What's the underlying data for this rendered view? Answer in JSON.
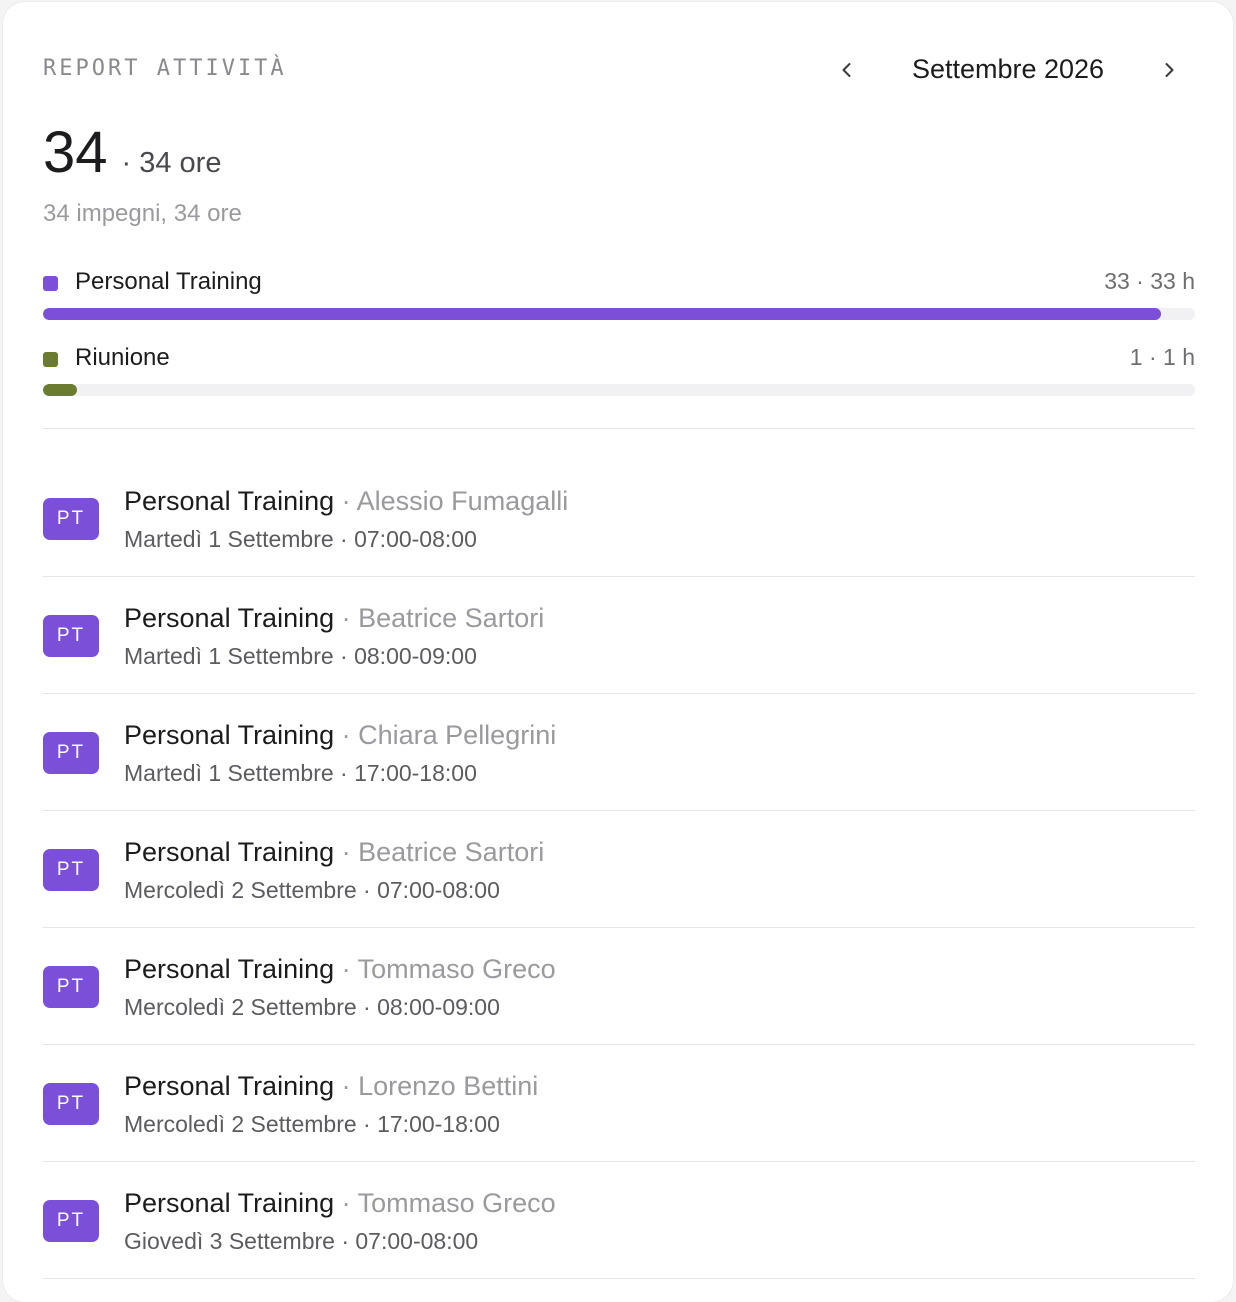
{
  "header": {
    "section_title": "REPORT ATTIVITÀ",
    "month": "Settembre 2026",
    "prev_icon": "chevron-left-icon",
    "next_icon": "chevron-right-icon"
  },
  "summary": {
    "total": "34",
    "hours": "· 34 ore",
    "subtitle": "34 impegni, 34 ore"
  },
  "categories": [
    {
      "name": "Personal Training",
      "count": "33 · 33 h",
      "color": "#7b4fd8",
      "fraction": 0.9706
    },
    {
      "name": "Riunione",
      "count": "1 · 1 h",
      "color": "#6b7b2f",
      "fraction": 0.0294
    }
  ],
  "colors": {
    "badge": "#7b4fd8"
  },
  "items": [
    {
      "badge": "PT",
      "title": "Personal Training",
      "sep": " · ",
      "client": "Alessio Fumagalli",
      "when": "Martedì 1 Settembre · 07:00-08:00"
    },
    {
      "badge": "PT",
      "title": "Personal Training",
      "sep": " · ",
      "client": "Beatrice Sartori",
      "when": "Martedì 1 Settembre · 08:00-09:00"
    },
    {
      "badge": "PT",
      "title": "Personal Training",
      "sep": " · ",
      "client": "Chiara Pellegrini",
      "when": "Martedì 1 Settembre · 17:00-18:00"
    },
    {
      "badge": "PT",
      "title": "Personal Training",
      "sep": " · ",
      "client": "Beatrice Sartori",
      "when": "Mercoledì 2 Settembre · 07:00-08:00"
    },
    {
      "badge": "PT",
      "title": "Personal Training",
      "sep": " · ",
      "client": "Tommaso Greco",
      "when": "Mercoledì 2 Settembre · 08:00-09:00"
    },
    {
      "badge": "PT",
      "title": "Personal Training",
      "sep": " · ",
      "client": "Lorenzo Bettini",
      "when": "Mercoledì 2 Settembre · 17:00-18:00"
    },
    {
      "badge": "PT",
      "title": "Personal Training",
      "sep": " · ",
      "client": "Tommaso Greco",
      "when": "Giovedì 3 Settembre · 07:00-08:00"
    }
  ]
}
